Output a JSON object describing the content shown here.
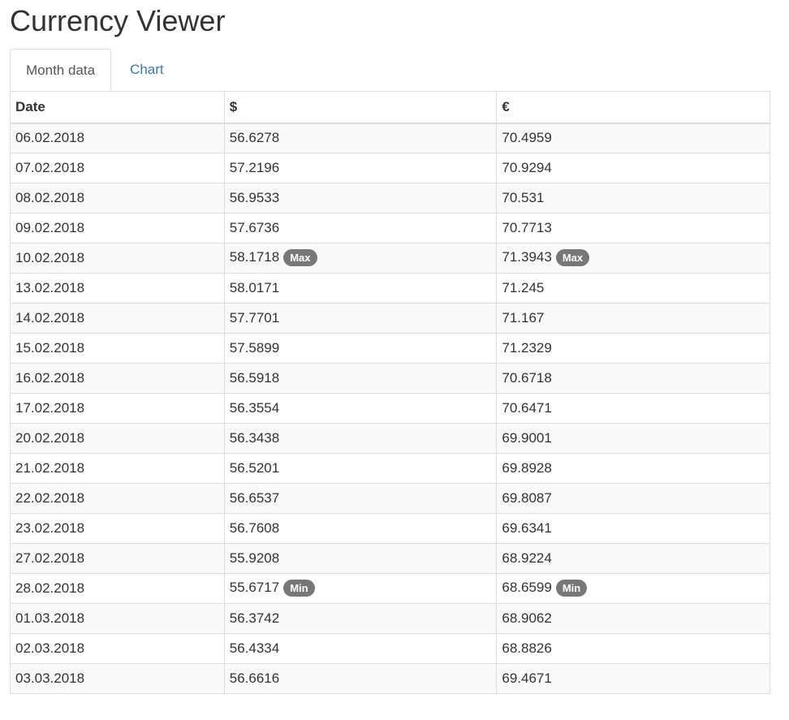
{
  "app": {
    "title": "Currency Viewer"
  },
  "tabs": [
    {
      "label": "Month data",
      "active": true
    },
    {
      "label": "Chart",
      "active": false
    }
  ],
  "table": {
    "headers": [
      "Date",
      "$",
      "€"
    ],
    "rows": [
      {
        "date": "06.02.2018",
        "usd": "56.6278",
        "usd_badge": "",
        "eur": "70.4959",
        "eur_badge": ""
      },
      {
        "date": "07.02.2018",
        "usd": "57.2196",
        "usd_badge": "",
        "eur": "70.9294",
        "eur_badge": ""
      },
      {
        "date": "08.02.2018",
        "usd": "56.9533",
        "usd_badge": "",
        "eur": "70.531",
        "eur_badge": ""
      },
      {
        "date": "09.02.2018",
        "usd": "57.6736",
        "usd_badge": "",
        "eur": "70.7713",
        "eur_badge": ""
      },
      {
        "date": "10.02.2018",
        "usd": "58.1718",
        "usd_badge": "Max",
        "eur": "71.3943",
        "eur_badge": "Max"
      },
      {
        "date": "13.02.2018",
        "usd": "58.0171",
        "usd_badge": "",
        "eur": "71.245",
        "eur_badge": ""
      },
      {
        "date": "14.02.2018",
        "usd": "57.7701",
        "usd_badge": "",
        "eur": "71.167",
        "eur_badge": ""
      },
      {
        "date": "15.02.2018",
        "usd": "57.5899",
        "usd_badge": "",
        "eur": "71.2329",
        "eur_badge": ""
      },
      {
        "date": "16.02.2018",
        "usd": "56.5918",
        "usd_badge": "",
        "eur": "70.6718",
        "eur_badge": ""
      },
      {
        "date": "17.02.2018",
        "usd": "56.3554",
        "usd_badge": "",
        "eur": "70.6471",
        "eur_badge": ""
      },
      {
        "date": "20.02.2018",
        "usd": "56.3438",
        "usd_badge": "",
        "eur": "69.9001",
        "eur_badge": ""
      },
      {
        "date": "21.02.2018",
        "usd": "56.5201",
        "usd_badge": "",
        "eur": "69.8928",
        "eur_badge": ""
      },
      {
        "date": "22.02.2018",
        "usd": "56.6537",
        "usd_badge": "",
        "eur": "69.8087",
        "eur_badge": ""
      },
      {
        "date": "23.02.2018",
        "usd": "56.7608",
        "usd_badge": "",
        "eur": "69.6341",
        "eur_badge": ""
      },
      {
        "date": "27.02.2018",
        "usd": "55.9208",
        "usd_badge": "",
        "eur": "68.9224",
        "eur_badge": ""
      },
      {
        "date": "28.02.2018",
        "usd": "55.6717",
        "usd_badge": "Min",
        "eur": "68.6599",
        "eur_badge": "Min"
      },
      {
        "date": "01.03.2018",
        "usd": "56.3742",
        "usd_badge": "",
        "eur": "68.9062",
        "eur_badge": ""
      },
      {
        "date": "02.03.2018",
        "usd": "56.4334",
        "usd_badge": "",
        "eur": "68.8826",
        "eur_badge": ""
      },
      {
        "date": "03.03.2018",
        "usd": "56.6616",
        "usd_badge": "",
        "eur": "69.4671",
        "eur_badge": ""
      }
    ]
  },
  "colors": {
    "link": "#337ab7",
    "badge_bg": "#777777",
    "stripe": "#f9f9f9",
    "border": "#dddddd"
  }
}
